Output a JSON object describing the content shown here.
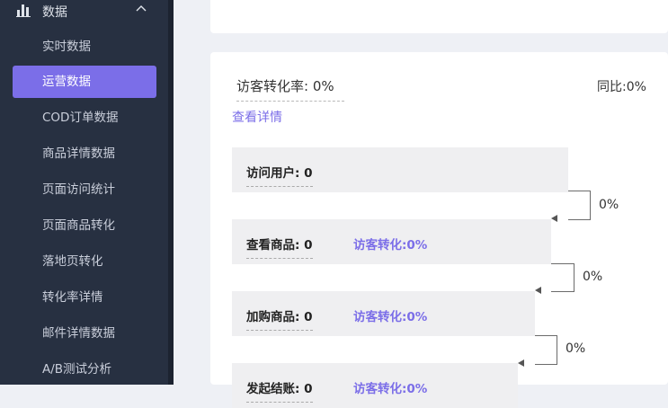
{
  "sidebar": {
    "group_label": "数据",
    "items": [
      {
        "label": "实时数据",
        "active": false
      },
      {
        "label": "运营数据",
        "active": true
      },
      {
        "label": "COD订单数据",
        "active": false
      },
      {
        "label": "商品详情数据",
        "active": false
      },
      {
        "label": "页面访问统计",
        "active": false
      },
      {
        "label": "页面商品转化",
        "active": false
      },
      {
        "label": "落地页转化",
        "active": false
      },
      {
        "label": "转化率详情",
        "active": false
      },
      {
        "label": "邮件详情数据",
        "active": false
      },
      {
        "label": "A/B测试分析",
        "active": false
      }
    ]
  },
  "main": {
    "visitor_rate_label": "访客转化率:",
    "visitor_rate_value": "0%",
    "yoy_label": "同比:",
    "yoy_value": "0%",
    "detail_link": "查看详情",
    "funnel": [
      {
        "metric_label": "访问用户:",
        "metric_value": "0"
      },
      {
        "metric_label": "查看商品:",
        "metric_value": "0",
        "conv_label": "访客转化:",
        "conv_value": "0%"
      },
      {
        "metric_label": "加购商品:",
        "metric_value": "0",
        "conv_label": "访客转化:",
        "conv_value": "0%"
      },
      {
        "metric_label": "发起结账:",
        "metric_value": "0",
        "conv_label": "访客转化:",
        "conv_value": "0%"
      }
    ],
    "step_rates": [
      "0%",
      "0%",
      "0%"
    ]
  },
  "colors": {
    "sidebar_bg": "#273041",
    "accent": "#7b6ee8",
    "page_bg": "#eef0f5"
  }
}
